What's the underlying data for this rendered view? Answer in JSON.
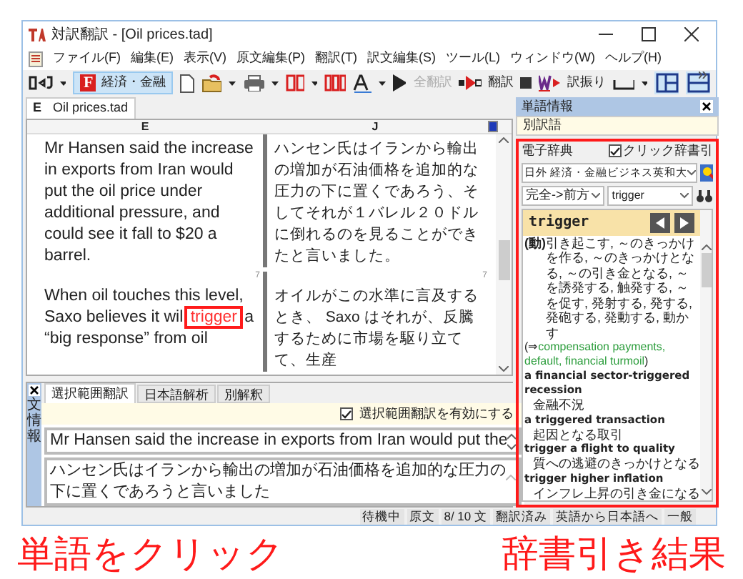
{
  "window": {
    "title": "対訳翻訳 - [Oil prices.tad]"
  },
  "menu": [
    "ファイル(F)",
    "編集(E)",
    "表示(V)",
    "原文編集(P)",
    "翻訳(T)",
    "訳文編集(S)",
    "ツール(L)",
    "ウィンドウ(W)",
    "ヘルプ(H)"
  ],
  "toolbar": {
    "field_badge": "F",
    "field_label": "経済・金融",
    "translate_all": {
      "label": "全翻訳",
      "disabled": true
    },
    "translate": {
      "label": "翻訳",
      "disabled": false
    },
    "pick": {
      "label": "訳振り",
      "disabled": false
    }
  },
  "doc_tab": {
    "badge": "E",
    "label": "Oil prices.tad"
  },
  "columns": [
    "E",
    "J"
  ],
  "sentences": [
    {
      "en": [
        {
          "text": "Mr Hansen said the increase in exports from Iran would put the oil price under additional pressure, and could see it fall to $20 a barrel.",
          "highlighted": false
        }
      ],
      "ja": "ハンセン氏はイランから輸出の増加が石油価格を追加的な圧力の下に置くであろう、そしてそれが１バレル２０ドルに倒れるのを見ることができたと言いました。",
      "numbers": [
        "7",
        "7"
      ]
    },
    {
      "en": [
        {
          "text": "When oil touches this level, Saxo believes it wil ",
          "highlighted": false
        },
        {
          "text": "trigger",
          "highlighted": true
        },
        {
          "text": " a “big response” from oil",
          "highlighted": false
        }
      ],
      "ja": "オイルがこの水準に言及するとき、 Saxo はそれが、反騰するために市場を駆り立てて、生産"
    }
  ],
  "word_panel": {
    "title": "単語情報",
    "alt_label": "別訳語",
    "dictionary": {
      "title": "電子辞典",
      "click_lookup": {
        "label": "クリック辞書引",
        "checked": true
      },
      "dictionary_select": "日外 経済・金融ビジネス英和大",
      "mode_select": "完全->前方",
      "search_value": "trigger",
      "headword": "trigger",
      "entries": [
        {
          "kind": "definition",
          "pos": "(動)",
          "text": "引き起こす, ～のきっかけを作る, ～のきっかけとなる, ～の引き金となる, ～を誘発する, 触発する, ～を促す, 発射する, 発する, 発砲する, 発動する, 動かす"
        },
        {
          "kind": "see",
          "prefix": "(⇒",
          "links": "compensation payments, default, financial turmoil",
          "suffix": ")"
        },
        {
          "kind": "phrase",
          "phrase": "a financial sector-triggered recession",
          "meaning": "金融不況"
        },
        {
          "kind": "phrase",
          "phrase": "a triggered transaction",
          "meaning": "起因となる取引"
        },
        {
          "kind": "phrase",
          "phrase": "trigger a flight to quality",
          "meaning": "質への逃避のきっかけとなる"
        },
        {
          "kind": "phrase",
          "phrase": "trigger higher inflation",
          "meaning": "インフレ上昇の引き金になる"
        }
      ]
    }
  },
  "sentence_panel": {
    "side_label": "文情報",
    "tabs": [
      {
        "label": "選択範囲翻訳",
        "selected": true
      },
      {
        "label": "日本語解析",
        "selected": false
      },
      {
        "label": "別解釈",
        "selected": false
      }
    ],
    "enable": {
      "label": "選択範囲翻訳を有効にする",
      "checked": true
    },
    "source": "Mr Hansen said the increase in exports from Iran would put the",
    "target": "ハンセン氏はイランから輸出の増加が石油価格を追加的な圧力の下に置くであろうと言いました"
  },
  "status_bar": [
    "待機中",
    "原文",
    "8/ 10 文",
    "翻訳済み",
    "英語から日本語へ",
    "一般"
  ],
  "annotations": [
    {
      "text": "単語をクリック"
    },
    {
      "text": "辞書引き結果"
    }
  ]
}
